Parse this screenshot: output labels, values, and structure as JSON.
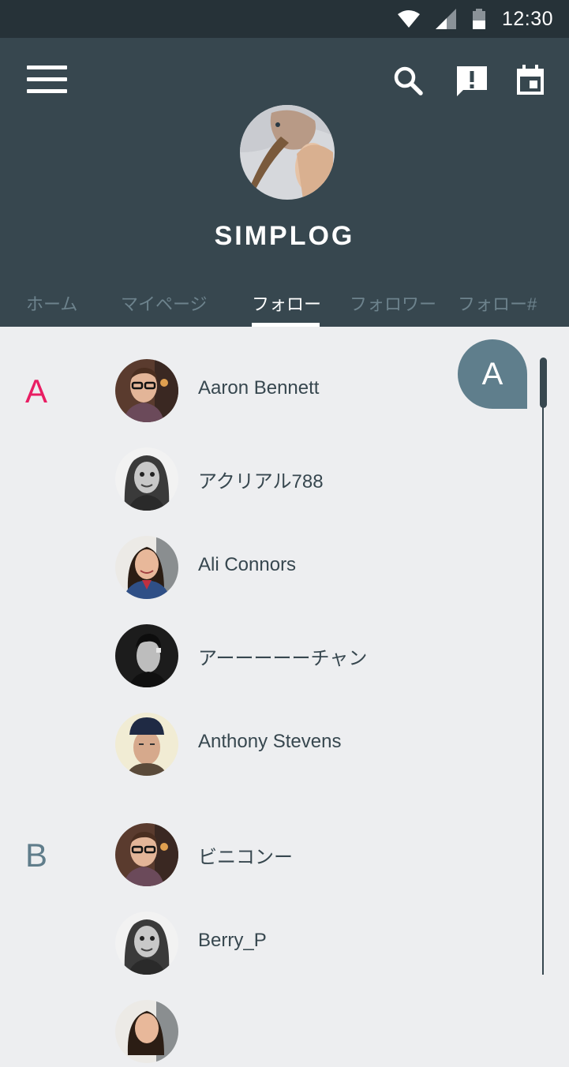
{
  "status_bar": {
    "time": "12:30"
  },
  "app": {
    "title": "SIMPLOG"
  },
  "tabs": [
    {
      "label": "ホーム"
    },
    {
      "label": "マイページ"
    },
    {
      "label": "フォロー",
      "active": true
    },
    {
      "label": "フォロワー"
    },
    {
      "label": "フォロー#"
    }
  ],
  "colors": {
    "appbar": "#37474f",
    "statusbar": "#263238",
    "accent": "#e91e63",
    "section_b": "#607d8b",
    "bubble": "#5f7e8c",
    "background": "#edeef0"
  },
  "sections": [
    {
      "letter": "A",
      "contacts": [
        {
          "name": "Aaron Bennett",
          "avatar": "man-glasses-avatar"
        },
        {
          "name": "アクリアル788",
          "avatar": "woman-bw-avatar"
        },
        {
          "name": "Ali Connors",
          "avatar": "woman-smiling-avatar"
        },
        {
          "name": "アーーーーーチャン",
          "avatar": "man-bw-avatar"
        },
        {
          "name": "Anthony Stevens",
          "avatar": "man-hat-avatar"
        }
      ]
    },
    {
      "letter": "B",
      "contacts": [
        {
          "name": "ビニコンー",
          "avatar": "man-glasses-avatar"
        },
        {
          "name": "Berry_P",
          "avatar": "woman-bw-avatar"
        }
      ]
    }
  ],
  "scroll_bubble": {
    "letter": "A"
  }
}
